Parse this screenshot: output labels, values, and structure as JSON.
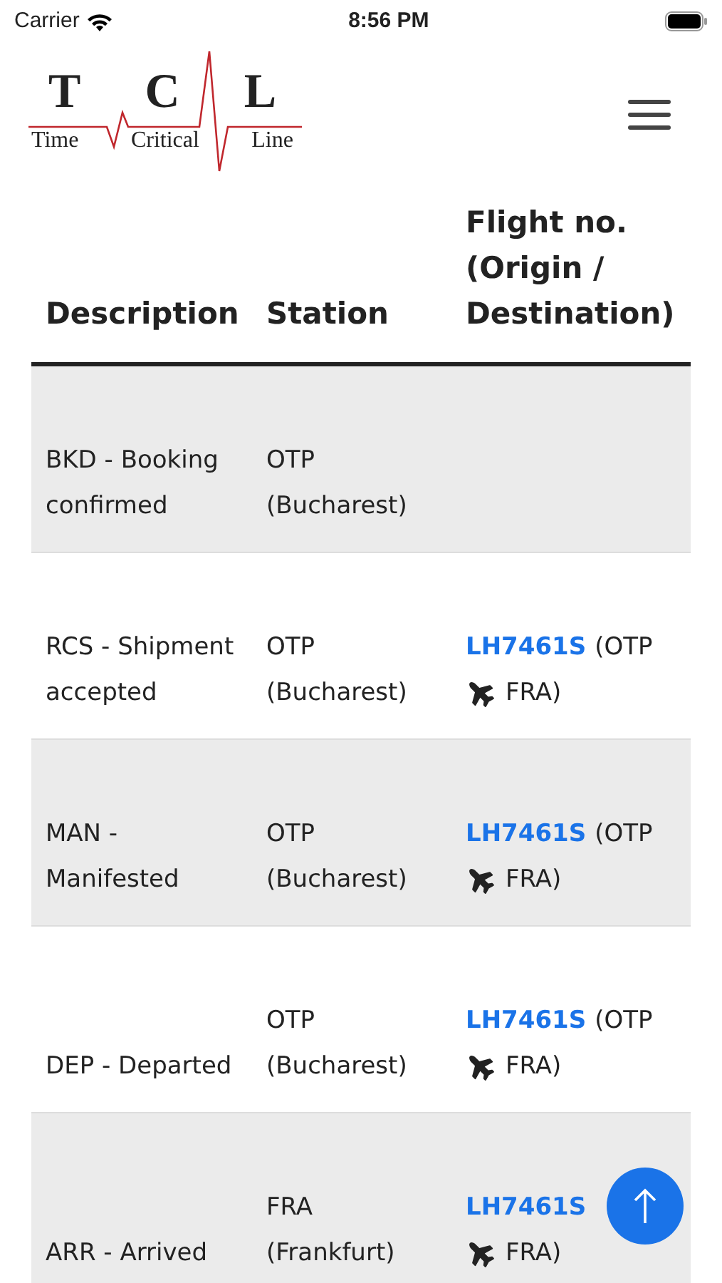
{
  "status_bar": {
    "carrier": "Carrier",
    "time": "8:56 PM"
  },
  "logo": {
    "letters": [
      "T",
      "C",
      "L"
    ],
    "words": [
      "Time",
      "Critical",
      "Line"
    ]
  },
  "table": {
    "columns": [
      "Description",
      "Station",
      "Flight no. (Origin / Destination)"
    ],
    "rows": [
      {
        "description": "BKD - Booking confirmed",
        "station": "OTP (Bucharest)"
      },
      {
        "description": "RCS - Shipment accepted",
        "station": "OTP (Bucharest)",
        "flight": {
          "code": "LH7461S",
          "origin": "(OTP",
          "destination": "FRA)"
        }
      },
      {
        "description": "MAN - Manifested",
        "station": "OTP (Bucharest)",
        "flight": {
          "code": "LH7461S",
          "origin": "(OTP",
          "destination": "FRA)"
        }
      },
      {
        "description": "DEP - Departed",
        "station": "OTP (Bucharest)",
        "flight": {
          "code": "LH7461S",
          "origin": "(OTP",
          "destination": "FRA)"
        }
      },
      {
        "description": "ARR - Arrived",
        "station": "FRA (Frankfurt)",
        "flight": {
          "code": "LH7461S",
          "destination": "FRA)"
        }
      }
    ]
  }
}
